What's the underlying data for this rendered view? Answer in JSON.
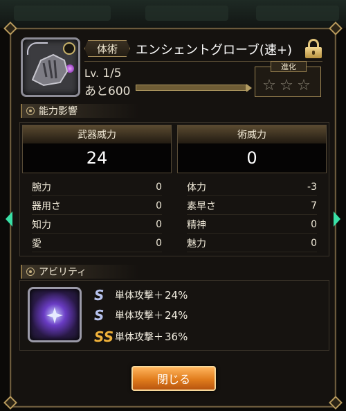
{
  "item": {
    "type_tag": "体術",
    "name": "エンシェントグローブ(速+)",
    "level_label": "Lv.",
    "level_value": "1/5",
    "remaining": "あと600",
    "evolution_label": "進化",
    "evolution_stars": 3
  },
  "stats_section": {
    "title": "能力影響",
    "weapon_power_label": "武器威力",
    "weapon_power_value": "24",
    "art_power_label": "術威力",
    "art_power_value": "0",
    "rows": [
      {
        "label": "腕力",
        "value": "0"
      },
      {
        "label": "器用さ",
        "value": "0"
      },
      {
        "label": "知力",
        "value": "0"
      },
      {
        "label": "愛",
        "value": "0"
      },
      {
        "label": "体力",
        "value": "-3"
      },
      {
        "label": "素早さ",
        "value": "7"
      },
      {
        "label": "精神",
        "value": "0"
      },
      {
        "label": "魅力",
        "value": "0"
      }
    ]
  },
  "ability_section": {
    "title": "アビリティ",
    "abilities": [
      {
        "name": "単体攻撃＋",
        "value": "24%",
        "tier": "silver"
      },
      {
        "name": "単体攻撃＋",
        "value": "24%",
        "tier": "silver"
      },
      {
        "name": "単体攻撃＋",
        "value": "36%",
        "tier": "gold"
      }
    ]
  },
  "buttons": {
    "close": "閉じる"
  },
  "colors": {
    "frame_gold": "#b89a5c",
    "button_orange": "#e07c1c",
    "nav_arrow": "#39e0a6"
  }
}
